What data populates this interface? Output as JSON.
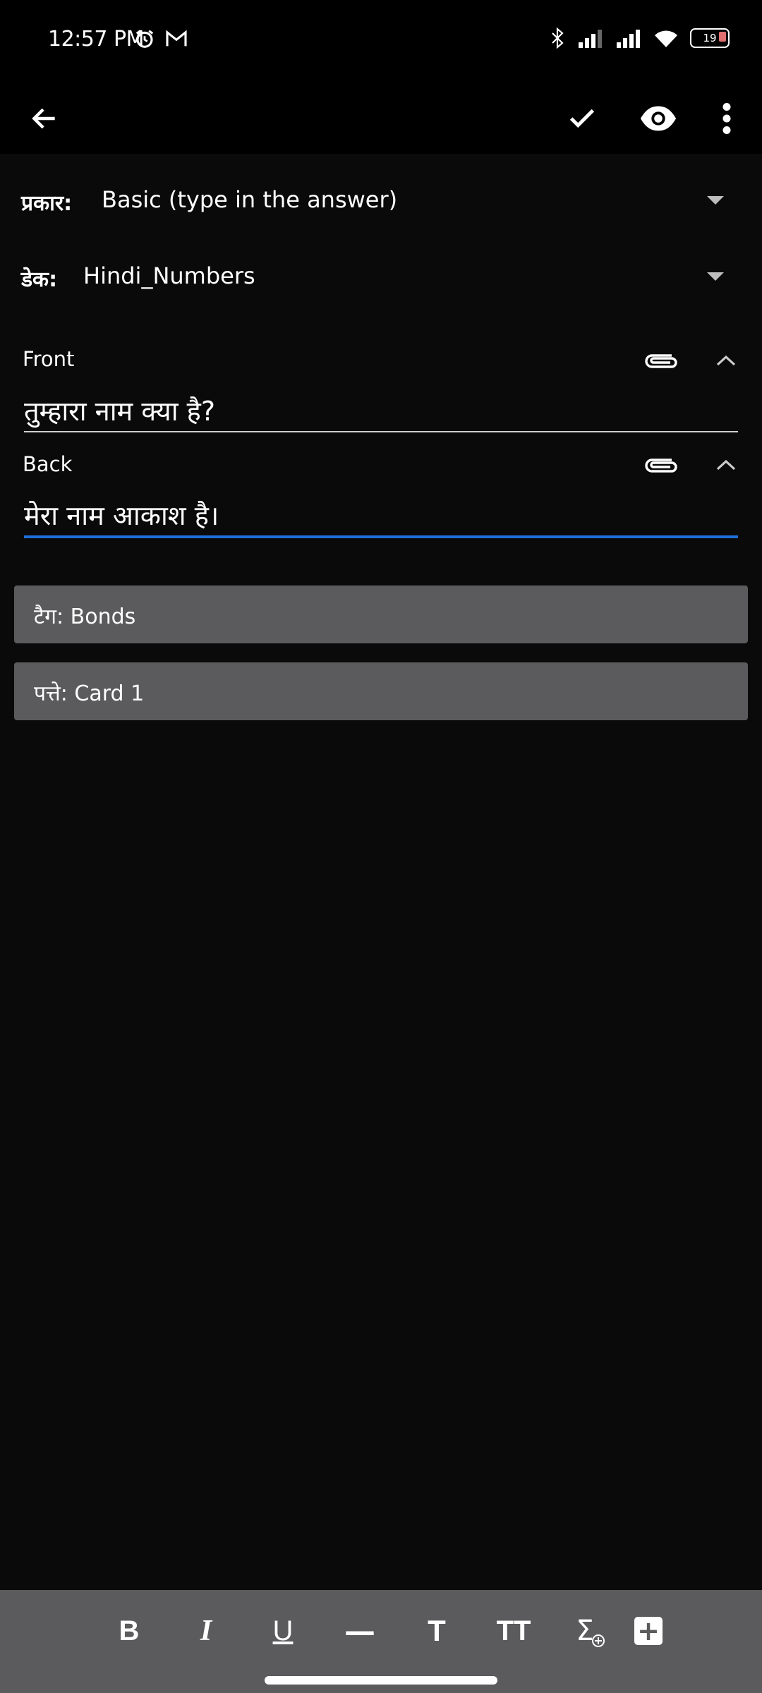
{
  "status_bar": {
    "time": "12:57 PM",
    "battery": "19",
    "icons": [
      "alarm-icon",
      "gmail-icon",
      "bluetooth-icon",
      "signal-icon",
      "signal-icon",
      "wifi-icon",
      "battery-icon"
    ]
  },
  "app_bar": {
    "back_icon": "arrow-left-icon",
    "actions": [
      "check-icon",
      "eye-icon",
      "more-vert-icon"
    ]
  },
  "note_type": {
    "label": "प्रकार:",
    "value": "Basic (type in the answer)"
  },
  "deck": {
    "label": "डेक:",
    "value": "Hindi_Numbers"
  },
  "fields": [
    {
      "label": "Front",
      "value": "तुम्हारा नाम क्या है?"
    },
    {
      "label": "Back",
      "value": "मेरा नाम आकाश है।"
    }
  ],
  "tags": {
    "text": "टैग: Bonds"
  },
  "cards": {
    "text": "पत्ते: Card 1"
  },
  "toolbar": {
    "bold": "B",
    "italic": "I",
    "underline": "U",
    "hr": "—",
    "font_size": "T",
    "heading": "TT",
    "math": "Σ",
    "insert": "+"
  },
  "colors": {
    "background": "#0a0a0a",
    "bar_background": "#000000",
    "chip_background": "#5b5b5d",
    "focus_underline": "#1e6fd9"
  }
}
